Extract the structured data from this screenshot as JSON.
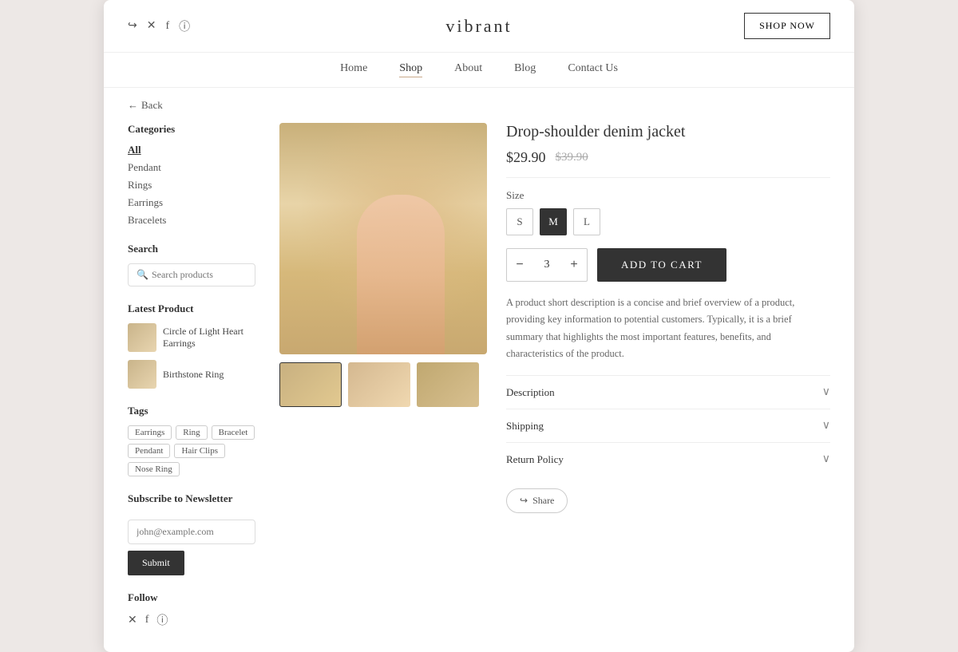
{
  "header": {
    "logo": "vibrant",
    "shop_now_label": "SHOP NOW",
    "social_icons": [
      "share",
      "x",
      "facebook",
      "instagram"
    ]
  },
  "nav": {
    "items": [
      {
        "label": "Home",
        "active": false
      },
      {
        "label": "Shop",
        "active": true
      },
      {
        "label": "About",
        "active": false
      },
      {
        "label": "Blog",
        "active": false
      },
      {
        "label": "Contact Us",
        "active": false
      }
    ]
  },
  "back": {
    "label": "Back"
  },
  "sidebar": {
    "categories_title": "Categories",
    "categories": [
      {
        "label": "All",
        "active": true
      },
      {
        "label": "Pendant",
        "active": false
      },
      {
        "label": "Rings",
        "active": false
      },
      {
        "label": "Earrings",
        "active": false
      },
      {
        "label": "Bracelets",
        "active": false
      }
    ],
    "search_title": "Search",
    "search_placeholder": "Search products",
    "latest_title": "Latest Product",
    "latest_items": [
      {
        "label": "Circle of Light Heart Earrings"
      },
      {
        "label": "Birthstone Ring"
      }
    ],
    "tags_title": "Tags",
    "tags": [
      "Earrings",
      "Ring",
      "Bracelet",
      "Pendant",
      "Hair Clips",
      "Nose Ring"
    ],
    "newsletter_title": "Subscribe to Newsletter",
    "newsletter_placeholder": "john@example.com",
    "submit_label": "Submit",
    "follow_title": "Follow"
  },
  "product": {
    "title": "Drop-shoulder denim jacket",
    "price_current": "$29.90",
    "price_original": "$39.90",
    "size_label": "Size",
    "sizes": [
      "S",
      "M",
      "L"
    ],
    "selected_size": "M",
    "quantity": "3",
    "add_to_cart_label": "ADD TO CART",
    "description": "A product short description is a concise and brief overview of a product, providing key information to potential customers. Typically, it is a brief summary that highlights the most important features, benefits, and characteristics of the product.",
    "accordion": [
      {
        "title": "Description"
      },
      {
        "title": "Shipping"
      },
      {
        "title": "Return Policy"
      }
    ],
    "share_label": "Share"
  }
}
